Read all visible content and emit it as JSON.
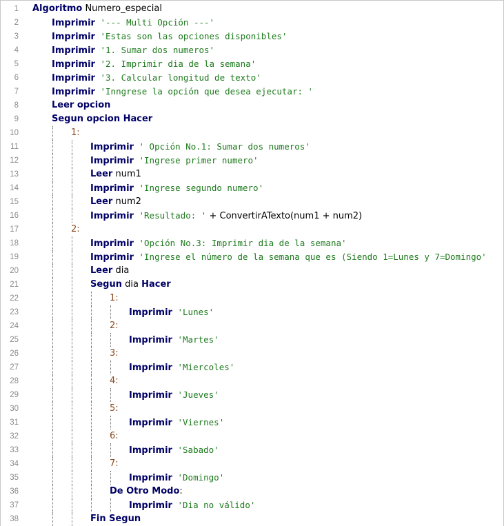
{
  "lines": [
    {
      "n": "1",
      "indent": 0,
      "guides": 0,
      "tokens": [
        {
          "t": "kw",
          "v": "Algoritmo"
        },
        {
          "t": "id",
          "v": " Numero_especial"
        }
      ]
    },
    {
      "n": "2",
      "indent": 1,
      "guides": 0,
      "tokens": [
        {
          "t": "kw",
          "v": "Imprimir"
        },
        {
          "t": "str",
          "v": " '--- Multi Opción ---'"
        }
      ]
    },
    {
      "n": "3",
      "indent": 1,
      "guides": 0,
      "tokens": [
        {
          "t": "kw",
          "v": "Imprimir"
        },
        {
          "t": "str",
          "v": " 'Estas son las opciones disponibles'"
        }
      ]
    },
    {
      "n": "4",
      "indent": 1,
      "guides": 0,
      "tokens": [
        {
          "t": "kw",
          "v": "Imprimir"
        },
        {
          "t": "str",
          "v": " '1. Sumar dos numeros'"
        }
      ]
    },
    {
      "n": "5",
      "indent": 1,
      "guides": 0,
      "tokens": [
        {
          "t": "kw",
          "v": "Imprimir"
        },
        {
          "t": "str",
          "v": " '2. Imprimir dia de la semana'"
        }
      ]
    },
    {
      "n": "6",
      "indent": 1,
      "guides": 0,
      "tokens": [
        {
          "t": "kw",
          "v": "Imprimir"
        },
        {
          "t": "str",
          "v": " '3. Calcular longitud de texto'"
        }
      ]
    },
    {
      "n": "7",
      "indent": 1,
      "guides": 0,
      "tokens": [
        {
          "t": "kw",
          "v": "Imprimir"
        },
        {
          "t": "str",
          "v": " 'Inngrese la opción que desea ejecutar: '"
        }
      ]
    },
    {
      "n": "8",
      "indent": 1,
      "guides": 0,
      "tokens": [
        {
          "t": "kw",
          "v": "Leer opcion"
        }
      ]
    },
    {
      "n": "9",
      "indent": 1,
      "guides": 0,
      "tokens": [
        {
          "t": "kw",
          "v": "Segun opcion Hacer"
        }
      ]
    },
    {
      "n": "10",
      "indent": 2,
      "guides": 1,
      "tokens": [
        {
          "t": "num",
          "v": "1:"
        }
      ]
    },
    {
      "n": "11",
      "indent": 3,
      "guides": 2,
      "tokens": [
        {
          "t": "kw",
          "v": "Imprimir"
        },
        {
          "t": "str",
          "v": " ' Opción No.1: Sumar dos numeros'"
        }
      ]
    },
    {
      "n": "12",
      "indent": 3,
      "guides": 2,
      "tokens": [
        {
          "t": "kw",
          "v": "Imprimir"
        },
        {
          "t": "str",
          "v": " 'Ingrese primer numero'"
        }
      ]
    },
    {
      "n": "13",
      "indent": 3,
      "guides": 2,
      "tokens": [
        {
          "t": "kw",
          "v": "Leer"
        },
        {
          "t": "id",
          "v": " num1"
        }
      ]
    },
    {
      "n": "14",
      "indent": 3,
      "guides": 2,
      "tokens": [
        {
          "t": "kw",
          "v": "Imprimir"
        },
        {
          "t": "str",
          "v": " 'Ingrese segundo numero'"
        }
      ]
    },
    {
      "n": "15",
      "indent": 3,
      "guides": 2,
      "tokens": [
        {
          "t": "kw",
          "v": "Leer"
        },
        {
          "t": "id",
          "v": " num2"
        }
      ]
    },
    {
      "n": "16",
      "indent": 3,
      "guides": 2,
      "tokens": [
        {
          "t": "kw",
          "v": "Imprimir"
        },
        {
          "t": "str",
          "v": " 'Resultado: '"
        },
        {
          "t": "op",
          "v": " + "
        },
        {
          "t": "id",
          "v": "ConvertirATexto(num1 + num2)"
        }
      ]
    },
    {
      "n": "17",
      "indent": 2,
      "guides": 1,
      "tokens": [
        {
          "t": "num",
          "v": "2:"
        }
      ]
    },
    {
      "n": "18",
      "indent": 3,
      "guides": 2,
      "tokens": [
        {
          "t": "kw",
          "v": "Imprimir"
        },
        {
          "t": "str",
          "v": " 'Opción No.3: Imprimir dia de la semana'"
        }
      ]
    },
    {
      "n": "19",
      "indent": 3,
      "guides": 2,
      "tokens": [
        {
          "t": "kw",
          "v": "Imprimir"
        },
        {
          "t": "str",
          "v": " 'Ingrese el número de la semana que es (Siendo 1=Lunes y 7=Domingo'"
        }
      ]
    },
    {
      "n": "20",
      "indent": 3,
      "guides": 2,
      "tokens": [
        {
          "t": "kw",
          "v": "Leer"
        },
        {
          "t": "id",
          "v": " dia"
        }
      ]
    },
    {
      "n": "21",
      "indent": 3,
      "guides": 2,
      "tokens": [
        {
          "t": "kw",
          "v": "Segun"
        },
        {
          "t": "id",
          "v": " dia "
        },
        {
          "t": "kw",
          "v": "Hacer"
        }
      ]
    },
    {
      "n": "22",
      "indent": 4,
      "guides": 3,
      "tokens": [
        {
          "t": "num",
          "v": "1:"
        }
      ]
    },
    {
      "n": "23",
      "indent": 5,
      "guides": 4,
      "tokens": [
        {
          "t": "kw",
          "v": "Imprimir"
        },
        {
          "t": "str",
          "v": " 'Lunes'"
        }
      ]
    },
    {
      "n": "24",
      "indent": 4,
      "guides": 3,
      "tokens": [
        {
          "t": "num",
          "v": "2:"
        }
      ]
    },
    {
      "n": "25",
      "indent": 5,
      "guides": 4,
      "tokens": [
        {
          "t": "kw",
          "v": "Imprimir"
        },
        {
          "t": "str",
          "v": " 'Martes'"
        }
      ]
    },
    {
      "n": "26",
      "indent": 4,
      "guides": 3,
      "tokens": [
        {
          "t": "num",
          "v": "3:"
        }
      ]
    },
    {
      "n": "27",
      "indent": 5,
      "guides": 4,
      "tokens": [
        {
          "t": "kw",
          "v": "Imprimir"
        },
        {
          "t": "str",
          "v": " 'Miercoles'"
        }
      ]
    },
    {
      "n": "28",
      "indent": 4,
      "guides": 3,
      "tokens": [
        {
          "t": "num",
          "v": "4:"
        }
      ]
    },
    {
      "n": "29",
      "indent": 5,
      "guides": 4,
      "tokens": [
        {
          "t": "kw",
          "v": "Imprimir"
        },
        {
          "t": "str",
          "v": " 'Jueves'"
        }
      ]
    },
    {
      "n": "30",
      "indent": 4,
      "guides": 3,
      "tokens": [
        {
          "t": "num",
          "v": "5:"
        }
      ]
    },
    {
      "n": "31",
      "indent": 5,
      "guides": 4,
      "tokens": [
        {
          "t": "kw",
          "v": "Imprimir"
        },
        {
          "t": "str",
          "v": " 'Viernes'"
        }
      ]
    },
    {
      "n": "32",
      "indent": 4,
      "guides": 3,
      "tokens": [
        {
          "t": "num",
          "v": "6:"
        }
      ]
    },
    {
      "n": "33",
      "indent": 5,
      "guides": 4,
      "tokens": [
        {
          "t": "kw",
          "v": "Imprimir"
        },
        {
          "t": "str",
          "v": " 'Sabado'"
        }
      ]
    },
    {
      "n": "34",
      "indent": 4,
      "guides": 3,
      "tokens": [
        {
          "t": "num",
          "v": "7:"
        }
      ]
    },
    {
      "n": "35",
      "indent": 5,
      "guides": 4,
      "tokens": [
        {
          "t": "kw",
          "v": "Imprimir"
        },
        {
          "t": "str",
          "v": " 'Domingo'"
        }
      ]
    },
    {
      "n": "36",
      "indent": 4,
      "guides": 3,
      "tokens": [
        {
          "t": "kw",
          "v": "De Otro Modo"
        },
        {
          "t": "op",
          "v": ":"
        }
      ]
    },
    {
      "n": "37",
      "indent": 5,
      "guides": 4,
      "tokens": [
        {
          "t": "kw",
          "v": "Imprimir"
        },
        {
          "t": "str",
          "v": " 'Dia no válido'"
        }
      ]
    },
    {
      "n": "38",
      "indent": 3,
      "guides": 2,
      "tokens": [
        {
          "t": "kw",
          "v": "Fin Segun"
        }
      ]
    }
  ]
}
